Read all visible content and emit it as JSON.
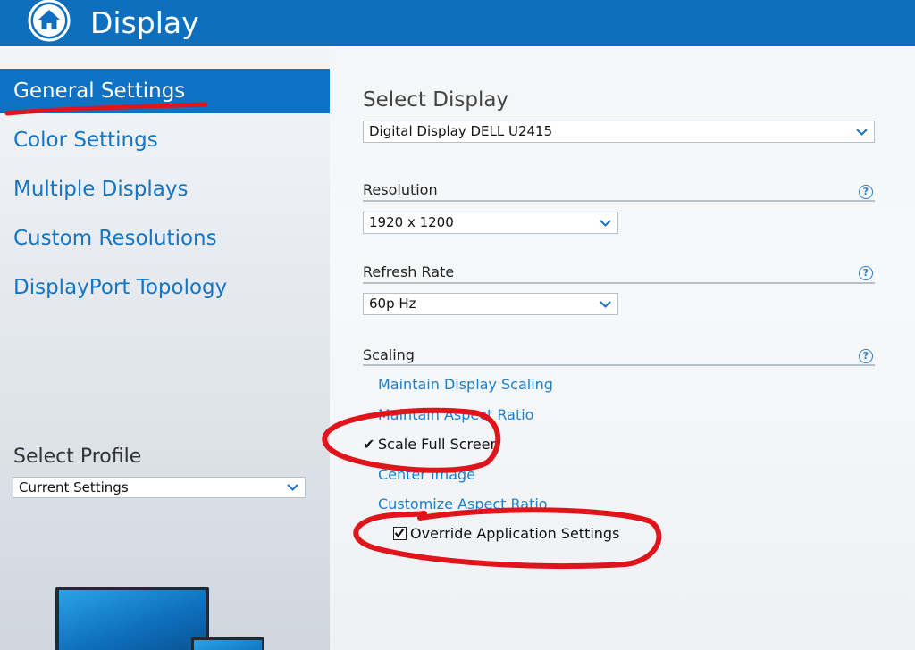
{
  "header": {
    "title": "Display",
    "icon": "home-icon"
  },
  "sidebar": {
    "items": [
      {
        "label": "General Settings",
        "active": true
      },
      {
        "label": "Color Settings"
      },
      {
        "label": "Multiple Displays"
      },
      {
        "label": "Custom Resolutions"
      },
      {
        "label": "DisplayPort Topology"
      }
    ],
    "profile_label": "Select Profile",
    "profile_value": "Current Settings"
  },
  "main": {
    "select_display_title": "Select Display",
    "display_value": "Digital Display DELL U2415",
    "resolution_label": "Resolution",
    "resolution_value": "1920 x 1200",
    "refresh_label": "Refresh Rate",
    "refresh_value": "60p Hz",
    "scaling_label": "Scaling",
    "scaling_options": [
      {
        "label": "Maintain Display Scaling"
      },
      {
        "label": "Maintain Aspect Ratio"
      },
      {
        "label": "Scale Full Screen",
        "selected": true,
        "mark": "✔"
      },
      {
        "label": "Center Image"
      },
      {
        "label": "Customize Aspect Ratio"
      }
    ],
    "override_label": "Override Application Settings",
    "override_checked": true,
    "help_glyph": "?"
  },
  "colors": {
    "accent": "#0e6fbe",
    "link": "#1376c6",
    "annotation": "#e0141b"
  }
}
